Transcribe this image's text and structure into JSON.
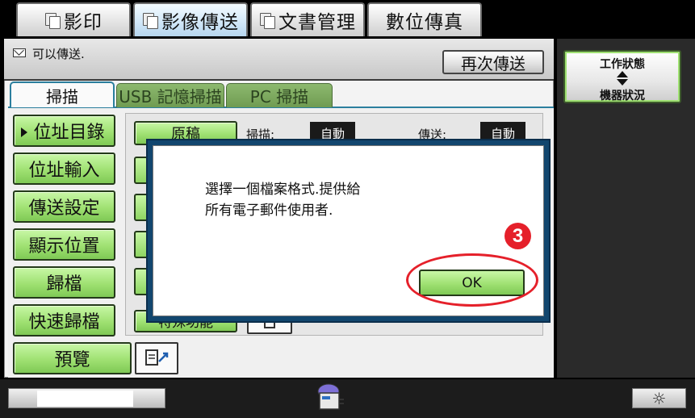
{
  "top_tabs": [
    {
      "label": "影印"
    },
    {
      "label": "影像傳送"
    },
    {
      "label": "文書管理"
    },
    {
      "label": "數位傳真"
    }
  ],
  "status": {
    "message": "可以傳送."
  },
  "resend": {
    "label": "再次傳送"
  },
  "sub_tabs": [
    {
      "label": "掃描"
    },
    {
      "label": "USB 記憶掃描"
    },
    {
      "label": "PC 掃描"
    }
  ],
  "left_menu": [
    {
      "label": "位址目錄"
    },
    {
      "label": "位址輸入"
    },
    {
      "label": "傳送設定"
    },
    {
      "label": "顯示位置"
    },
    {
      "label": "歸檔"
    },
    {
      "label": "快速歸檔"
    }
  ],
  "preview": {
    "label": "預覽"
  },
  "settings": {
    "original_label": "原稿",
    "scan_label": "掃描:",
    "scan_value": "自動",
    "send_label": "傳送:",
    "send_value": "自動",
    "special_label": "特殊功能"
  },
  "side": {
    "job_status": "工作狀態",
    "machine_status": "機器狀況"
  },
  "dialog": {
    "message": "選擇一個檔案格式.提供給\n所有電子郵件使用者.",
    "ok_label": "OK",
    "step_number": "3"
  },
  "bottom": {
    "brightness_symbol": "☼"
  },
  "colors": {
    "accent_green": "#9fe172",
    "dialog_border": "#12466e",
    "highlight_red": "#e5202a"
  }
}
